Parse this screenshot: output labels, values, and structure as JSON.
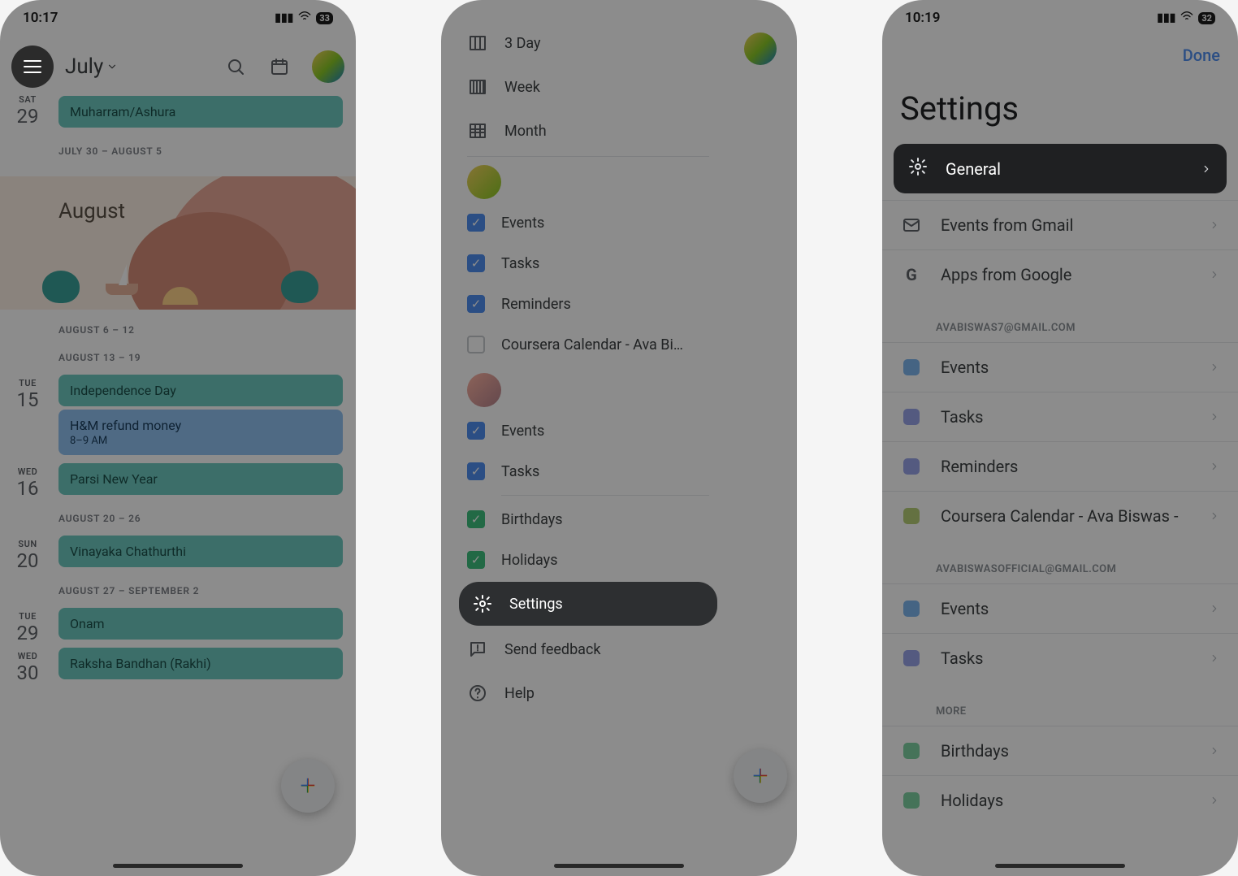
{
  "screen1": {
    "status_time": "10:17",
    "battery": "33",
    "month": "July",
    "first_day": {
      "dow": "SAT",
      "dom": "29",
      "event": "Muharram/Ashura"
    },
    "week1": "JULY 30 – AUGUST 5",
    "hero_month": "August",
    "week2": "AUGUST 6 – 12",
    "week3": "AUGUST 13 – 19",
    "d15": {
      "dow": "TUE",
      "dom": "15",
      "ev1": "Independence Day",
      "ev2": "H&M refund money",
      "ev2_time": "8–9 AM"
    },
    "d16": {
      "dow": "WED",
      "dom": "16",
      "ev": "Parsi New Year"
    },
    "week4": "AUGUST 20 – 26",
    "d20": {
      "dow": "SUN",
      "dom": "20",
      "ev": "Vinayaka Chathurthi"
    },
    "week5": "AUGUST 27 – SEPTEMBER 2",
    "d29": {
      "dow": "TUE",
      "dom": "29",
      "ev": "Onam"
    },
    "d30": {
      "dow": "WED",
      "dom": "30",
      "ev": "Raksha Bandhan (Rakhi)"
    }
  },
  "screen2": {
    "view_3day": "3 Day",
    "view_week": "Week",
    "view_month": "Month",
    "acct1": {
      "events": "Events",
      "tasks": "Tasks",
      "reminders": "Reminders",
      "coursera": "Coursera Calendar - Ava Biswas -…"
    },
    "acct2": {
      "events": "Events",
      "tasks": "Tasks"
    },
    "birthdays": "Birthdays",
    "holidays": "Holidays",
    "settings": "Settings",
    "feedback": "Send feedback",
    "help": "Help"
  },
  "screen3": {
    "status_time": "10:19",
    "battery": "32",
    "done": "Done",
    "title": "Settings",
    "general": "General",
    "events_gmail": "Events from Gmail",
    "apps_google": "Apps from Google",
    "section_a": "AVABISWAS7@GMAIL.COM",
    "a_events": "Events",
    "a_tasks": "Tasks",
    "a_reminders": "Reminders",
    "a_coursera": "Coursera Calendar - Ava Biswas -",
    "section_b": "AVABISWASOFFICIAL@GMAIL.COM",
    "b_events": "Events",
    "b_tasks": "Tasks",
    "section_more": "MORE",
    "m_birthdays": "Birthdays",
    "m_holidays": "Holidays"
  }
}
